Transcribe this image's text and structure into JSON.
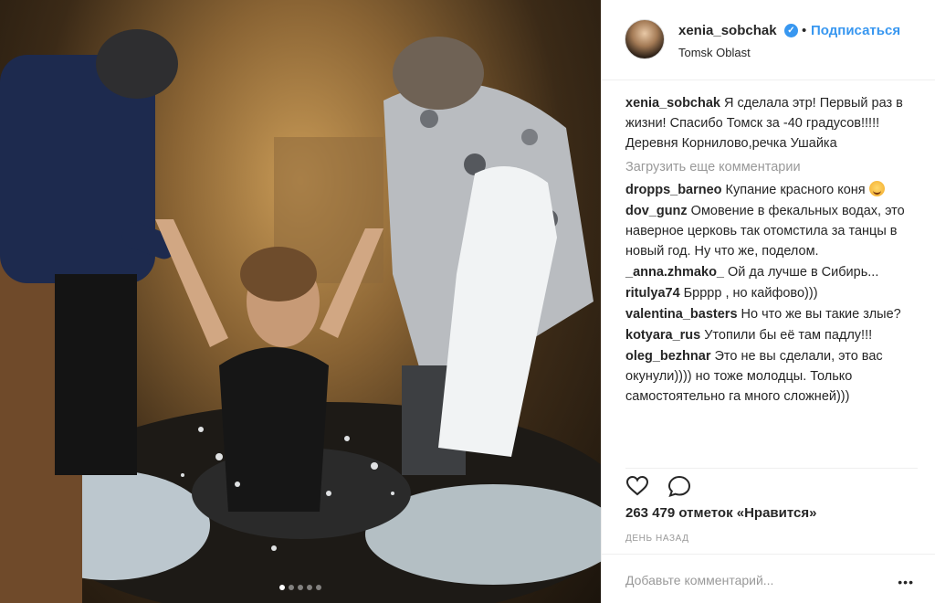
{
  "post": {
    "username": "xenia_sobchak",
    "verified_mark": "✓",
    "separator": "•",
    "follow_label": "Подписаться",
    "location": "Tomsk Oblast",
    "caption_user": "xenia_sobchak",
    "caption_text": "Я сделала этр! Первый раз в жизни! Спасибо Томск за -40 градусов!!!!! Деревня Корнилово,речка Ушайка",
    "load_more": "Загрузить еще комментарии",
    "comments": [
      {
        "user": "dropps_barneo",
        "text": "Купание красного коня"
      },
      {
        "user": "dov_gunz",
        "text": "Омовение в фекальных водах, это наверное церковь так отомстила за танцы в новый год. Ну что же, поделом."
      },
      {
        "user": "_anna.zhmako_",
        "text": "Ой да лучше в Сибирь..."
      },
      {
        "user": "ritulya74",
        "text": "Брррр , но кайфово)))"
      },
      {
        "user": "valentina_basters",
        "text": "Но что же вы такие злые?"
      },
      {
        "user": "kotyara_rus",
        "text": "Утопили бы её там падлу!!!"
      },
      {
        "user": "oleg_bezhnar",
        "text": "Это не вы сделали, это вас окунули)))) но тоже молодцы. Только самостоятельно га много сложней)))"
      }
    ],
    "likes": "263 479 отметок «Нравится»",
    "timestamp": "ДЕНЬ НАЗАД",
    "add_comment_placeholder": "Добавьте комментарий...",
    "more_label": "•••",
    "carousel_count": 5,
    "carousel_active": 1
  },
  "icons": {
    "like": "heart-icon",
    "comment": "comment-icon",
    "verified": "verified-badge-icon",
    "emoji": "smiling-face-emoji"
  },
  "colors": {
    "accent": "#3897f0",
    "text": "#262626",
    "muted": "#999999"
  }
}
